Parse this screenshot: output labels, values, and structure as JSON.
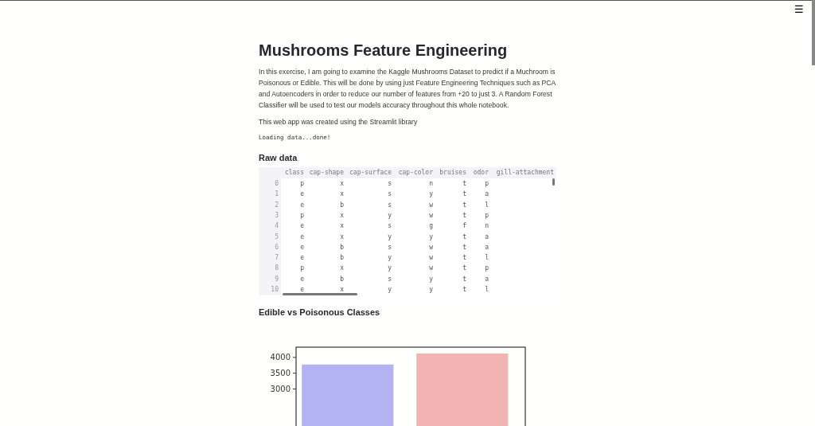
{
  "menu_icon": "☰",
  "title": "Mushrooms Feature Engineering",
  "intro": "In this exercise, I am going to examine the Kaggle Mushrooms Dataset to predict if a Muchroom is Poisonous or Edible. This will be done by using just Feature Engineering Techniques such as PCA and Autoencoders in order to reduce our number of features from +20 to just 3. A Random Forest Classifier will be used to test our models accuracy throughout this whole notebook.",
  "note": "This web app was created using the Streamlit library",
  "status": "Loading data...done!",
  "raw_data": {
    "heading": "Raw data",
    "columns": [
      "class",
      "cap-shape",
      "cap-surface",
      "cap-color",
      "bruises",
      "odor",
      "gill-attachment"
    ],
    "rows": [
      {
        "index": "0",
        "cells": [
          "p",
          "x",
          "s",
          "n",
          "t",
          "p"
        ]
      },
      {
        "index": "1",
        "cells": [
          "e",
          "x",
          "s",
          "y",
          "t",
          "a"
        ]
      },
      {
        "index": "2",
        "cells": [
          "e",
          "b",
          "s",
          "w",
          "t",
          "l"
        ]
      },
      {
        "index": "3",
        "cells": [
          "p",
          "x",
          "y",
          "w",
          "t",
          "p"
        ]
      },
      {
        "index": "4",
        "cells": [
          "e",
          "x",
          "s",
          "g",
          "f",
          "n"
        ]
      },
      {
        "index": "5",
        "cells": [
          "e",
          "x",
          "y",
          "y",
          "t",
          "a"
        ]
      },
      {
        "index": "6",
        "cells": [
          "e",
          "b",
          "s",
          "w",
          "t",
          "a"
        ]
      },
      {
        "index": "7",
        "cells": [
          "e",
          "b",
          "y",
          "w",
          "t",
          "l"
        ]
      },
      {
        "index": "8",
        "cells": [
          "p",
          "x",
          "y",
          "w",
          "t",
          "p"
        ]
      },
      {
        "index": "9",
        "cells": [
          "e",
          "b",
          "s",
          "y",
          "t",
          "a"
        ]
      },
      {
        "index": "10",
        "cells": [
          "e",
          "x",
          "y",
          "y",
          "t",
          "l"
        ]
      }
    ]
  },
  "class_chart": {
    "heading": "Edible vs Poisonous Classes",
    "bars": [
      {
        "color": "#b3b3f3"
      },
      {
        "color": "#f2b3b3"
      }
    ],
    "y_tick_labels": [
      "4000",
      "3500",
      "3000"
    ]
  }
}
